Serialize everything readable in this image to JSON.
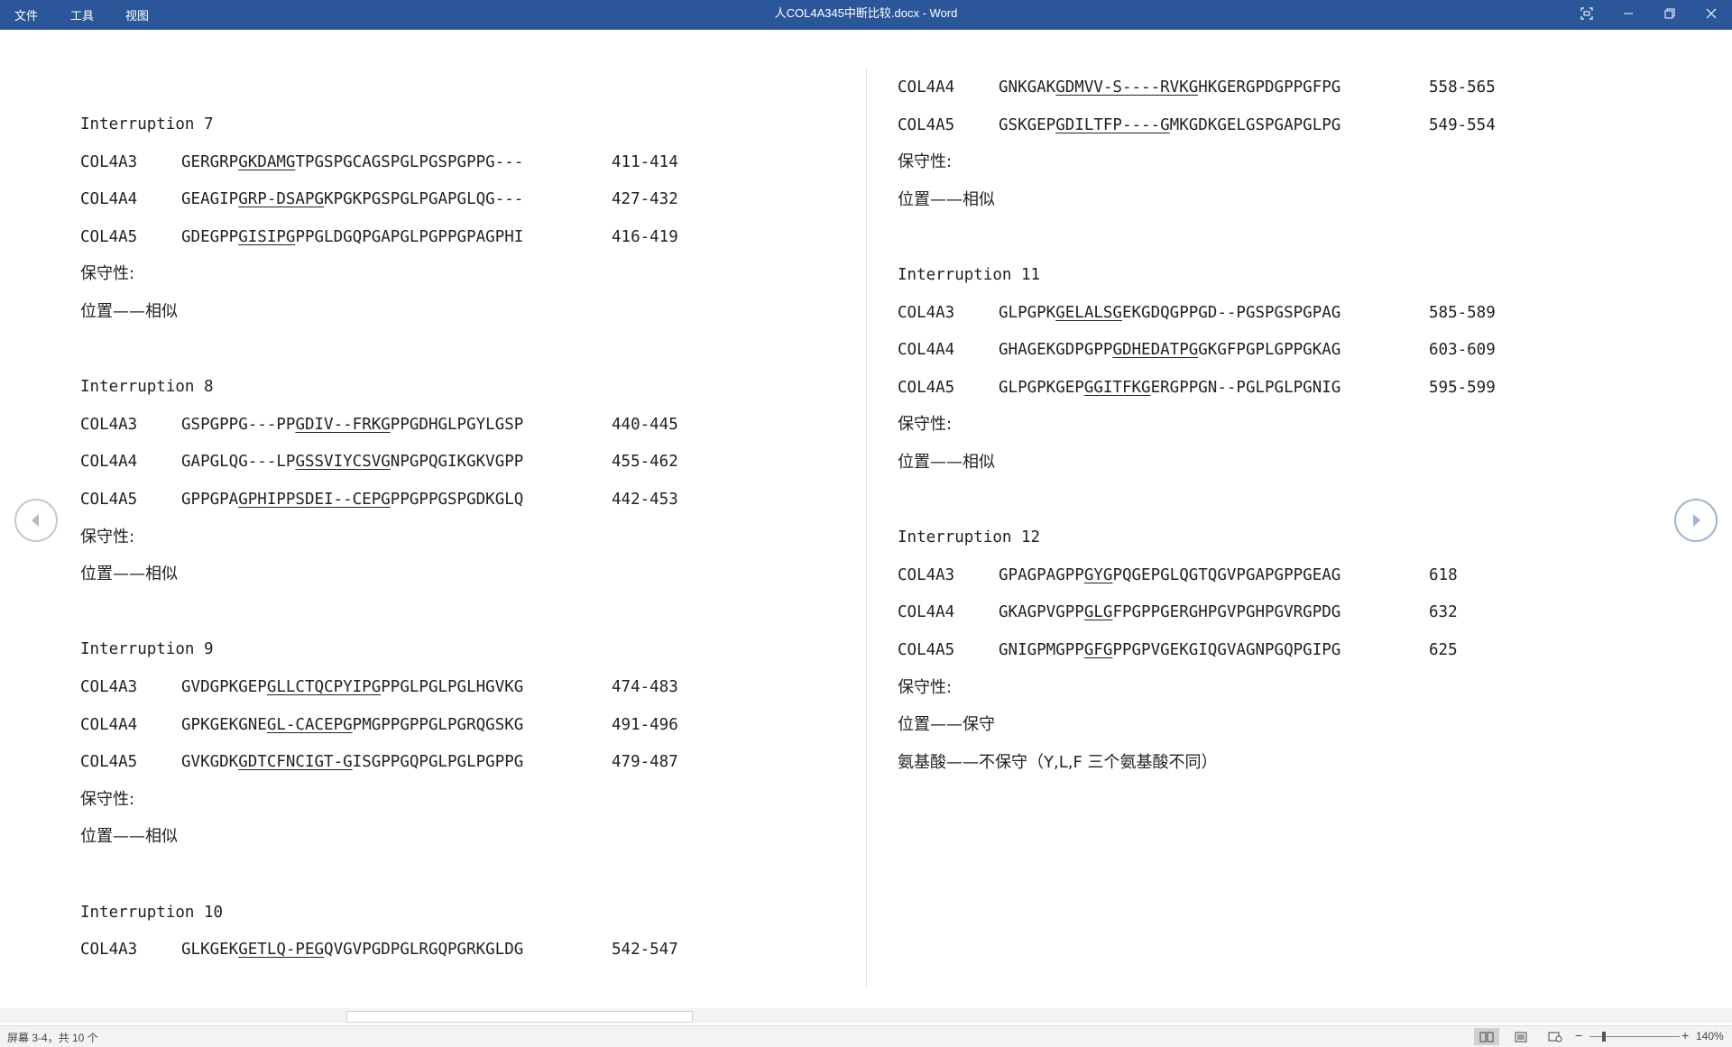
{
  "titlebar": {
    "menu": [
      "文件",
      "工具",
      "视图"
    ],
    "title": "人COL4A345中断比较.docx  -  Word"
  },
  "left_column": [
    {
      "type": "heading",
      "text": "Interruption 7"
    },
    {
      "type": "seq",
      "label": "COL4A3",
      "pre": "GERGRP",
      "u": "GKDAMG",
      "post": "TPGSPGCAGSPGLPGSPGPPG---",
      "range": "411-414"
    },
    {
      "type": "seq",
      "label": "COL4A4",
      "pre": "GEAGIP",
      "u": "GRP-DSAPG",
      "post": "KPGKPGSPGLPGAPGLQG---",
      "range": "427-432"
    },
    {
      "type": "seq",
      "label": "COL4A5",
      "pre": "GDEGPP",
      "u": "GISIPG",
      "post": "PPGLDGQPGAPGLPGPPGPAGPHI",
      "range": "416-419"
    },
    {
      "type": "cn",
      "text": "保守性:"
    },
    {
      "type": "cn",
      "text": "位置——相似"
    },
    {
      "type": "blank"
    },
    {
      "type": "heading",
      "text": "Interruption 8"
    },
    {
      "type": "seq",
      "label": "COL4A3",
      "pre": "GSPGPPG---PP",
      "u": "GDIV--FRKG",
      "post": "PPGDHGLPGYLGSP",
      "range": "440-445"
    },
    {
      "type": "seq",
      "label": "COL4A4",
      "pre": "GAPGLQG---LP",
      "u": "GSSVIYCSVG",
      "post": "NPGPQGIKGKVGPP",
      "range": "455-462"
    },
    {
      "type": "seq",
      "label": "COL4A5",
      "pre": "GPPGPA",
      "u": "GPHIPPSDEI--CEPG",
      "post": "PPGPPGSPGDKGLQ",
      "range": "442-453"
    },
    {
      "type": "cn",
      "text": "保守性:"
    },
    {
      "type": "cn",
      "text": "位置——相似"
    },
    {
      "type": "blank"
    },
    {
      "type": "heading",
      "text": "Interruption 9"
    },
    {
      "type": "seq",
      "label": "COL4A3",
      "pre": "GVDGPKGEP",
      "u": "GLLCTQCPYIPG",
      "post": "PPGLPGLPGLHGVKG",
      "range": "474-483"
    },
    {
      "type": "seq",
      "label": "COL4A4",
      "pre": "GPKGEKGNE",
      "u": "GL-CACEPG",
      "post": "PMGPPGPPGLPGRQGSKG",
      "range": "491-496"
    },
    {
      "type": "seq",
      "label": "COL4A5",
      "pre": "GVKGDK",
      "u": "GDTCFNCIGT-G",
      "post": "ISGPPGQPGLPGLPGPPG",
      "range": "479-487"
    },
    {
      "type": "cn",
      "text": "保守性:"
    },
    {
      "type": "cn",
      "text": "位置——相似"
    },
    {
      "type": "blank"
    },
    {
      "type": "heading",
      "text": "Interruption 10"
    },
    {
      "type": "seq",
      "label": "COL4A3",
      "pre": "GLKGEK",
      "u": "GETLQ-PEG",
      "post": "QVGVPGDPGLRGQPGRKGLDG",
      "range": "542-547"
    }
  ],
  "right_column": [
    {
      "type": "seq",
      "label": "COL4A4",
      "pre": "GNKGAK",
      "u": "GDMVV-S----RVKG",
      "post": "HKGERGPDGPPGFPG",
      "range": "558-565"
    },
    {
      "type": "seq",
      "label": "COL4A5",
      "pre": "GSKGEP",
      "u": "GDILTFP----G",
      "post": "MKGDKGELGSPGAPGLPG",
      "range": "549-554"
    },
    {
      "type": "cn",
      "text": "保守性:"
    },
    {
      "type": "cn",
      "text": "位置——相似"
    },
    {
      "type": "blank"
    },
    {
      "type": "heading",
      "text": "Interruption 11"
    },
    {
      "type": "seq",
      "label": "COL4A3",
      "pre": "GLPGPK",
      "u": "GELALSG",
      "post": "EKGDQGPPGD--PGSPGSPGPAG",
      "range": "585-589"
    },
    {
      "type": "seq",
      "label": "COL4A4",
      "pre": "GHAGEKGDPGPP",
      "u": "GDHEDATPG",
      "post": "GKGFPGPLGPPGKAG",
      "range": "603-609"
    },
    {
      "type": "seq",
      "label": "COL4A5",
      "pre": "GLPGPKGEP",
      "u": "GGITFKG",
      "post": "ERGPPGN--PGLPGLPGNIG",
      "range": "595-599"
    },
    {
      "type": "cn",
      "text": "保守性:"
    },
    {
      "type": "cn",
      "text": "位置——相似"
    },
    {
      "type": "blank"
    },
    {
      "type": "heading",
      "text": "Interruption 12"
    },
    {
      "type": "seq",
      "label": "COL4A3",
      "pre": "GPAGPAGPP",
      "u": "GYG",
      "post": "PQGEPGLQGTQGVPGAPGPPGEAG",
      "range": "618"
    },
    {
      "type": "seq",
      "label": "COL4A4",
      "pre": "GKAGPVGPP",
      "u": "GLG",
      "post": "FPGPPGERGHPGVPGHPGVRGPDG",
      "range": "632"
    },
    {
      "type": "seq",
      "label": "COL4A5",
      "pre": "GNIGPMGPP",
      "u": "GFG",
      "post": "PPGPVGEKGIQGVAGNPGQPGIPG",
      "range": "625"
    },
    {
      "type": "cn",
      "text": "保守性:"
    },
    {
      "type": "cn",
      "text": "位置——保守"
    },
    {
      "type": "cn",
      "text": "氨基酸——不保守（Y,L,F 三个氨基酸不同）"
    }
  ],
  "statusbar": {
    "page_info": "屏幕 3-4，共 10 个",
    "zoom": "140%"
  }
}
